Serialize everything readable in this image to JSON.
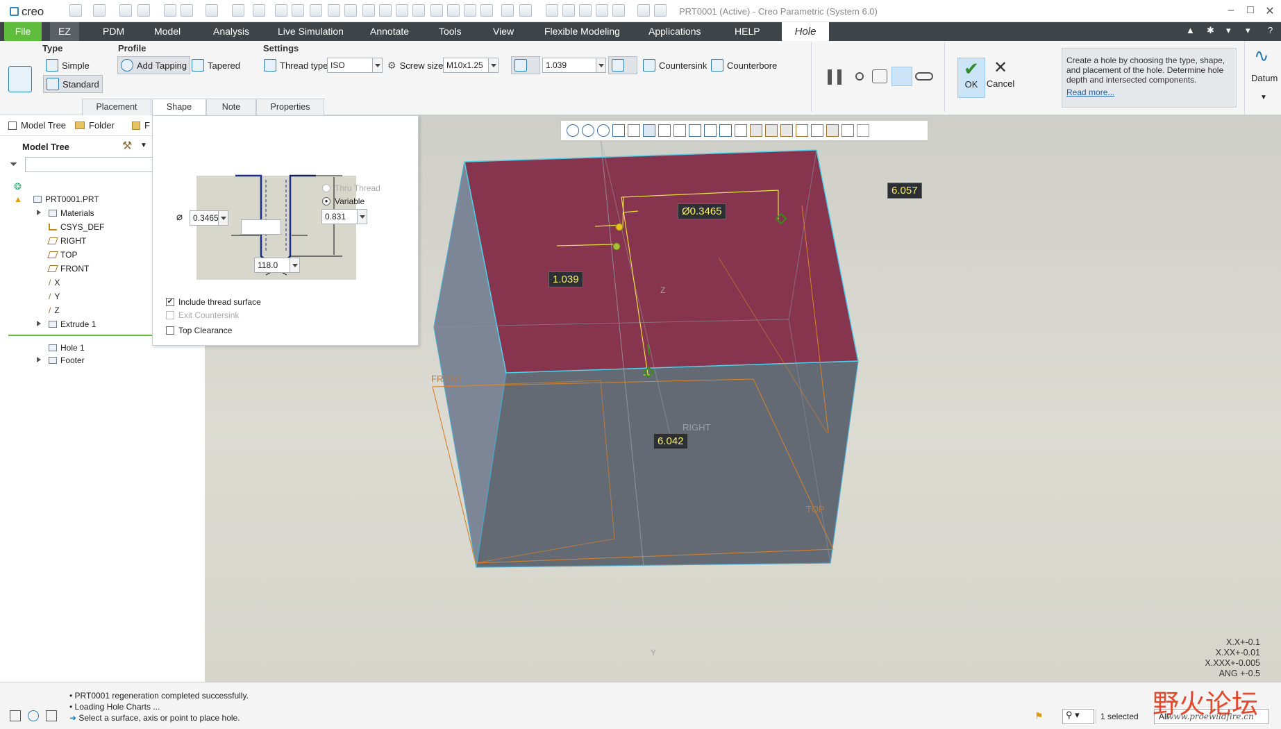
{
  "app": {
    "logo": "creo",
    "window_title": "PRT0001 (Active) - Creo Parametric (System 6.0)"
  },
  "tabs": [
    "File",
    "EZ",
    "PDM",
    "Model",
    "Analysis",
    "Live Simulation",
    "Annotate",
    "Tools",
    "View",
    "Flexible Modeling",
    "Applications",
    "HELP",
    "Hole"
  ],
  "ribbon": {
    "type_group": "Type",
    "simple": "Simple",
    "standard": "Standard",
    "profile_group": "Profile",
    "add_tapping": "Add Tapping",
    "tapered": "Tapered",
    "settings_group": "Settings",
    "thread_type_label": "Thread type:",
    "thread_type": "ISO",
    "screw_size_label": "Screw size:",
    "screw_size": "M10x1.25",
    "depth_value": "1.039",
    "countersink": "Countersink",
    "counterbore": "Counterbore",
    "ok": "OK",
    "cancel": "Cancel",
    "help_text": "Create a hole by choosing the type, shape, and placement of the hole. Determine hole depth and intersected components.",
    "read_more": "Read more...",
    "datum": "Datum"
  },
  "subtabs": [
    "Placement",
    "Shape",
    "Note",
    "Properties"
  ],
  "left": {
    "tab_model_tree": "Model Tree",
    "tab_folder": "Folder",
    "tab_f": "F",
    "header": "Model Tree",
    "tree": {
      "root": "PRT0001.PRT",
      "materials": "Materials",
      "csys": "CSYS_DEF",
      "right": "RIGHT",
      "top": "TOP",
      "front": "FRONT",
      "x": "X",
      "y": "Y",
      "z": "Z",
      "extrude": "Extrude 1",
      "hole": "Hole 1",
      "footer": "Footer"
    }
  },
  "shape": {
    "diameter": "0.3465",
    "depth": "0.831",
    "angle": "118.0",
    "thru_thread": "Thru Thread",
    "variable": "Variable",
    "include_thread": "Include thread surface",
    "exit_countersink": "Exit Countersink",
    "top_clearance": "Top Clearance"
  },
  "viewport": {
    "dim_top": "6.057",
    "dim_dia": "Ø0.3465",
    "dim_depth": "1.039",
    "dim_bottom": "6.042",
    "plane_front": "FRONT",
    "plane_right": "RIGHT",
    "plane_top": "TOP",
    "axis_y": "Y",
    "axis_z": "Z",
    "tol1": "X.X+-0.1",
    "tol2": "X.XX+-0.01",
    "tol3": "X.XXX+-0.005",
    "tol4": "ANG +-0.5"
  },
  "status": {
    "msg1": "PRT0001 regeneration completed successfully.",
    "msg2": "Loading Hole Charts ...",
    "msg3": "Select a surface, axis or point to place hole.",
    "selected": "1 selected",
    "filter": "All",
    "watermark": "野火论坛",
    "watermark_url": "www.proewildfire.cn"
  }
}
